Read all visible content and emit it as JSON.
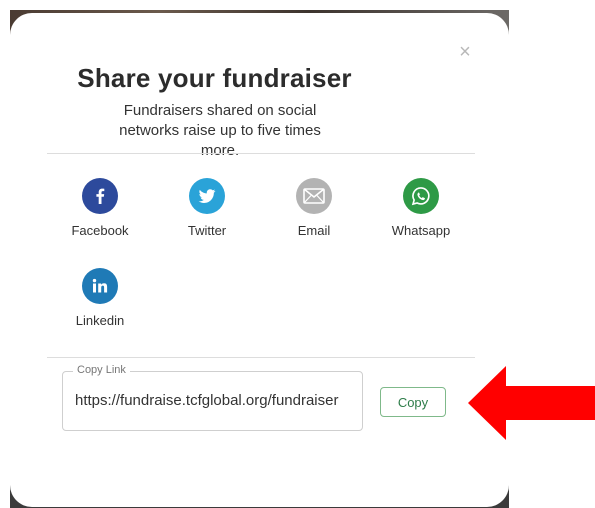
{
  "modal": {
    "title": "Share your fundraiser",
    "subtitle": "Fundraisers shared on social networks raise up to five times more.",
    "close_label": "×"
  },
  "share_options": [
    {
      "label": "Facebook",
      "icon": "facebook-icon",
      "color": "#2d4a9c"
    },
    {
      "label": "Twitter",
      "icon": "twitter-icon",
      "color": "#2aa3d8"
    },
    {
      "label": "Email",
      "icon": "email-icon",
      "color": "#b3b3b3"
    },
    {
      "label": "Whatsapp",
      "icon": "whatsapp-icon",
      "color": "#2e9a46"
    },
    {
      "label": "Linkedin",
      "icon": "linkedin-icon",
      "color": "#1f7ab6"
    }
  ],
  "copy_link": {
    "legend": "Copy Link",
    "value": "https://fundraise.tcfglobal.org/fundraiser",
    "button_label": "Copy"
  },
  "annotation": {
    "arrow_color": "#ff0000"
  }
}
